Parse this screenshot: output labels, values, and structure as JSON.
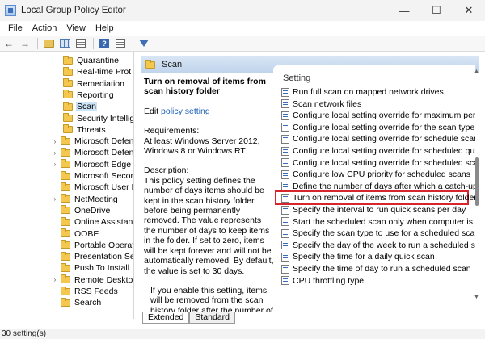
{
  "window": {
    "title": "Local Group Policy Editor",
    "minimize": "—",
    "maximize": "☐",
    "close": "✕"
  },
  "menu": [
    "File",
    "Action",
    "View",
    "Help"
  ],
  "toolbar": {
    "back": "←",
    "forward": "→"
  },
  "tree": {
    "items": [
      {
        "label": "Quarantine",
        "expander": ""
      },
      {
        "label": "Real-time Prot",
        "expander": ""
      },
      {
        "label": "Remediation",
        "expander": ""
      },
      {
        "label": "Reporting",
        "expander": ""
      },
      {
        "label": "Scan",
        "expander": "",
        "selected": true
      },
      {
        "label": "Security Intellig",
        "expander": ""
      },
      {
        "label": "Threats",
        "expander": ""
      },
      {
        "label": "Microsoft Defende",
        "expander": "›"
      },
      {
        "label": "Microsoft Defende",
        "expander": "›"
      },
      {
        "label": "Microsoft Edge",
        "expander": "›"
      },
      {
        "label": "Microsoft Second",
        "expander": ""
      },
      {
        "label": "Microsoft User Exp",
        "expander": ""
      },
      {
        "label": "NetMeeting",
        "expander": "›"
      },
      {
        "label": "OneDrive",
        "expander": ""
      },
      {
        "label": "Online Assistance",
        "expander": ""
      },
      {
        "label": "OOBE",
        "expander": ""
      },
      {
        "label": "Portable Operating",
        "expander": ""
      },
      {
        "label": "Presentation Settin",
        "expander": ""
      },
      {
        "label": "Push To Install",
        "expander": ""
      },
      {
        "label": "Remote Desktop S",
        "expander": "›"
      },
      {
        "label": "RSS Feeds",
        "expander": ""
      },
      {
        "label": "Search",
        "expander": ""
      }
    ]
  },
  "header": {
    "title": "Scan"
  },
  "description": {
    "title": "Turn on removal of items from scan history folder",
    "edit_prefix": "Edit ",
    "edit_link": "policy setting",
    "requirements": "Requirements:\nAt least Windows Server 2012, Windows 8 or Windows RT",
    "body": "Description:\nThis policy setting defines the number of days items should be kept in the scan history folder before being permanently removed. The value represents the number of days to keep items in the folder. If set to zero, items will be kept forever and will not be automatically removed. By default, the value is set to 30 days.",
    "enable": "If you enable this setting, items will be removed from the scan history folder after the number of days specified."
  },
  "settings": {
    "column_header": "Setting",
    "rows": [
      "Run full scan on mapped network drives",
      "Scan network files",
      "Configure local setting override for maximum percer",
      "Configure local setting override for the scan type to u",
      "Configure local setting override for schedule scan da",
      "Configure local setting override for scheduled quick",
      "Configure local setting override for scheduled scan ti",
      "Configure low CPU priority for scheduled scans",
      "Define the number of days after which a catch-up sc",
      "Turn on removal of items from scan history folder",
      "Specify the interval to run quick scans per day",
      "Start the scheduled scan only when computer is on b",
      "Specify the scan type to use for a scheduled scan",
      "Specify the day of the week to run a scheduled scan",
      "Specify the time for a daily quick scan",
      "Specify the time of day to run a scheduled scan",
      "CPU throttling type"
    ],
    "highlighted_index": 9
  },
  "tabs": {
    "extended": "Extended",
    "standard": "Standard"
  },
  "status": {
    "text": "30 setting(s)"
  },
  "colors": {
    "highlight": "#d6252d",
    "link": "#1a5fb4",
    "header": "#bfd3ec"
  }
}
